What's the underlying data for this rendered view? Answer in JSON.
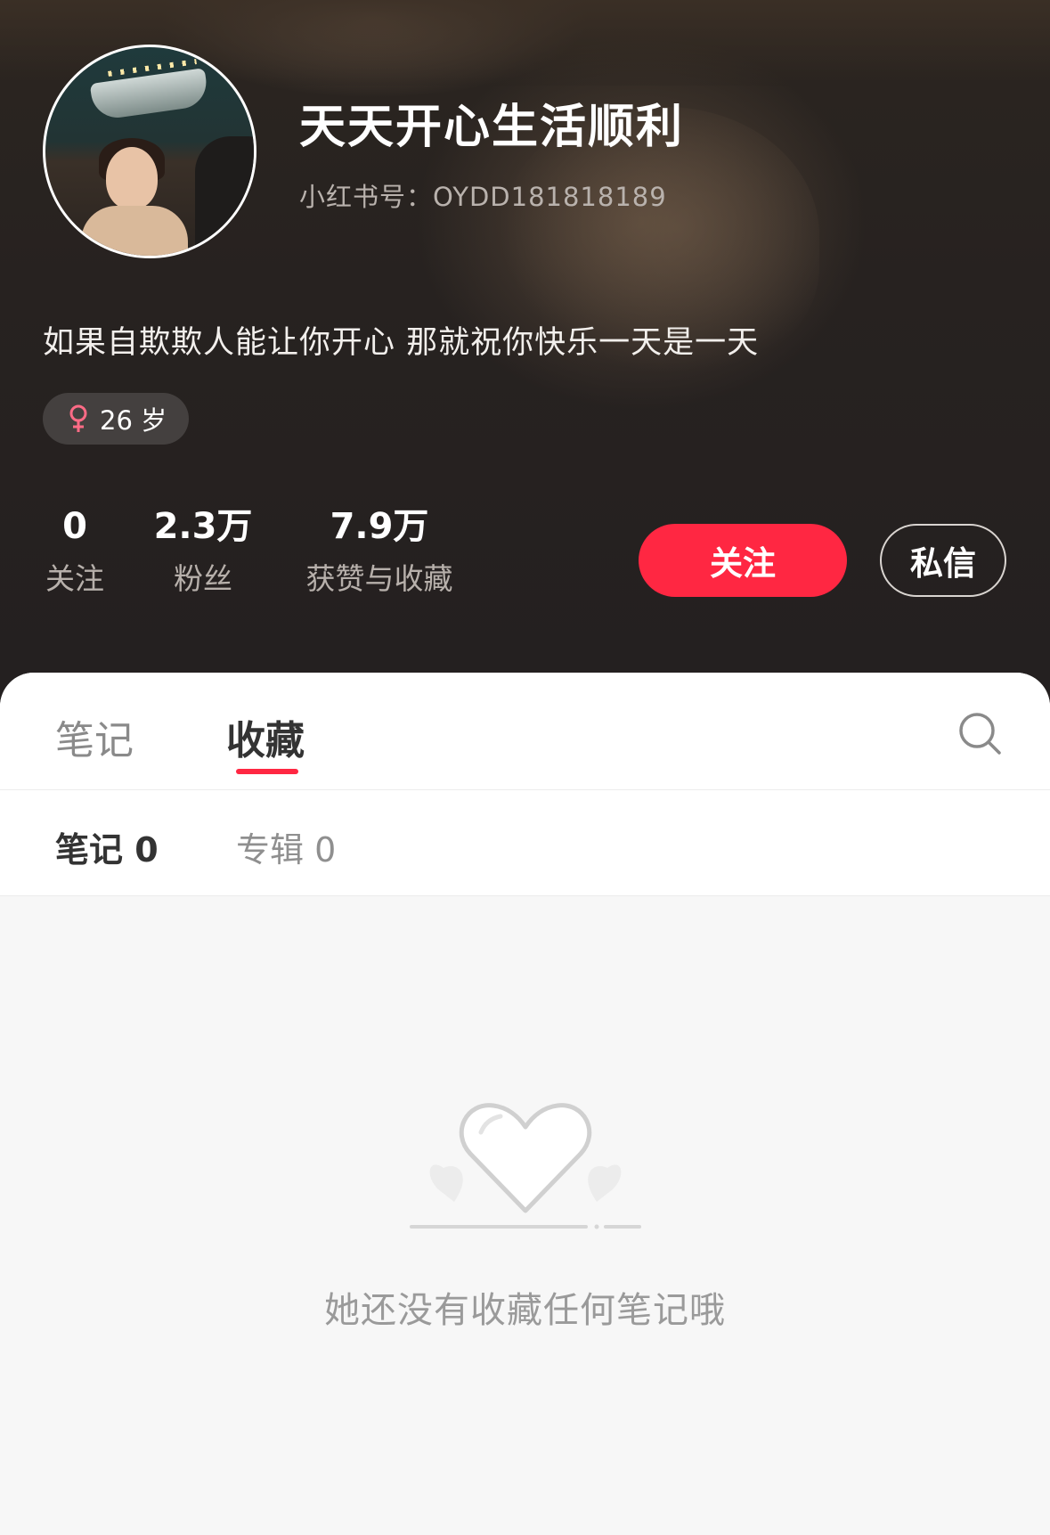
{
  "profile": {
    "username": "天天开心生活顺利",
    "redid": "小红书号：OYDD181818189",
    "bio": "如果自欺欺人能让你开心 那就祝你快乐一天是一天",
    "age_tag": "26 岁",
    "gender_icon": "female-icon"
  },
  "stats": [
    {
      "value": "0",
      "label": "关注"
    },
    {
      "value": "2.3万",
      "label": "粉丝"
    },
    {
      "value": "7.9万",
      "label": "获赞与收藏"
    }
  ],
  "actions": {
    "follow_label": "关注",
    "message_label": "私信",
    "follow_color": "#ff2742"
  },
  "tabs": [
    {
      "label": "笔记",
      "active": false
    },
    {
      "label": "收藏",
      "active": true
    }
  ],
  "subtabs": [
    {
      "label": "笔记 0",
      "active": true
    },
    {
      "label": "专辑 0",
      "active": false
    }
  ],
  "empty_state": {
    "icon": "heart-icon",
    "message": "她还没有收藏任何笔记哦"
  },
  "icons": {
    "search": "search-icon"
  }
}
